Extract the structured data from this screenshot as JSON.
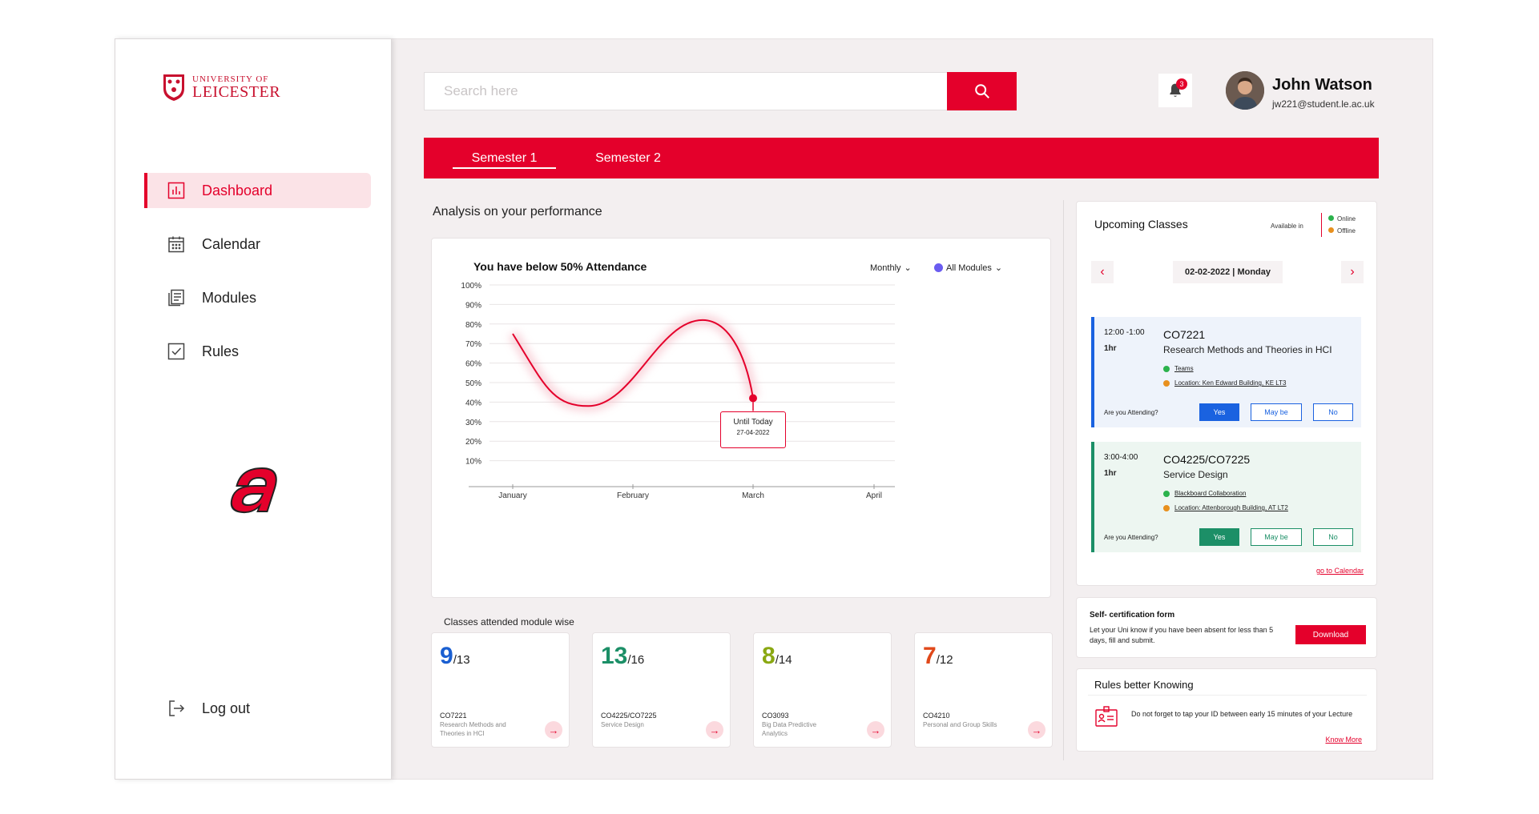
{
  "brand": {
    "line1": "UNIVERSITY OF",
    "line2": "LEICESTER"
  },
  "sidebar": {
    "items": [
      {
        "label": "Dashboard",
        "icon": "chart-icon",
        "active": true
      },
      {
        "label": "Calendar",
        "icon": "calendar-icon"
      },
      {
        "label": "Modules",
        "icon": "modules-icon"
      },
      {
        "label": "Rules",
        "icon": "checkbox-icon"
      }
    ],
    "logout_label": "Log out"
  },
  "search": {
    "placeholder": "Search here"
  },
  "notifications": {
    "count": "3"
  },
  "user": {
    "name": "John Watson",
    "email": "jw221@student.le.ac.uk"
  },
  "tabs": [
    {
      "label": "Semester 1",
      "active": true
    },
    {
      "label": "Semester 2"
    }
  ],
  "analysis": {
    "section_title": "Analysis on your performance",
    "title": "You have below 50% Attendance",
    "period_dropdown": "Monthly",
    "module_dropdown": "All Modules",
    "tooltip_title": "Until Today",
    "tooltip_date": "27-04-2022"
  },
  "chart_data": {
    "type": "line",
    "title": "You have below 50% Attendance",
    "x": [
      "January",
      "February",
      "March",
      "April"
    ],
    "y_ticks": [
      "100%",
      "90%",
      "80%",
      "70%",
      "60%",
      "50%",
      "40%",
      "30%",
      "20%",
      "10%"
    ],
    "ylim": [
      0,
      100
    ],
    "series": [
      {
        "color": "#e4002b",
        "points": [
          [
            0,
            75
          ],
          [
            0.63,
            38
          ],
          [
            1.58,
            82
          ],
          [
            2.0,
            42
          ]
        ]
      }
    ],
    "grid": true
  },
  "modules_section": {
    "title": "Classes attended module wise",
    "modules": [
      {
        "attended": "9",
        "total": "/13",
        "code": "CO7221",
        "name": "Research Methods and Theories in HCI",
        "color": "#1a5fd1"
      },
      {
        "attended": "13",
        "total": "/16",
        "code": "CO4225/CO7225",
        "name": "Service Design",
        "color": "#1c8f67"
      },
      {
        "attended": "8",
        "total": "/14",
        "code": "CO3093",
        "name": "Big Data Predictive Analytics",
        "color": "#8aa812"
      },
      {
        "attended": "7",
        "total": "/12",
        "code": "CO4210",
        "name": "Personal and Group Skills",
        "color": "#e0481a"
      }
    ]
  },
  "upcoming": {
    "title": "Upcoming Classes",
    "available_in": "Available in",
    "online": "Online",
    "offline": "Offline",
    "date": "02-02-2022 | Monday",
    "classes": [
      {
        "time": "12:00 -1:00",
        "duration": "1hr",
        "code": "CO7221",
        "name": "Research Methods and Theories in HCI",
        "online_link": "Teams",
        "location": "Location: Ken Edward Building, KE LT3",
        "ask": "Are you Attending?",
        "yes": "Yes",
        "maybe": "May be",
        "no": "No"
      },
      {
        "time": "3:00-4:00",
        "duration": "1hr",
        "code": "CO4225/CO7225",
        "name": "Service Design",
        "online_link": "Blackboard Collaboration",
        "location": "Location: Attenborough Building, AT LT2",
        "ask": "Are you Attending?",
        "yes": "Yes",
        "maybe": "May be",
        "no": "No"
      }
    ],
    "go_calendar": "go to Calendar"
  },
  "cert": {
    "title": "Self- certification form",
    "text": "Let your Uni know if you have been absent for less than 5 days, fill and submit.",
    "button": "Download"
  },
  "rules": {
    "title": "Rules better Knowing",
    "text": "Do not forget to tap your ID between early 15 minutes of your Lecture",
    "link": "Know More"
  },
  "colors": {
    "accent": "#e4002b",
    "blue": "#1a62e0",
    "green": "#1c8f67",
    "online": "#2bb24c",
    "offline": "#e8901e",
    "module_filter": "#6a5cf0"
  }
}
